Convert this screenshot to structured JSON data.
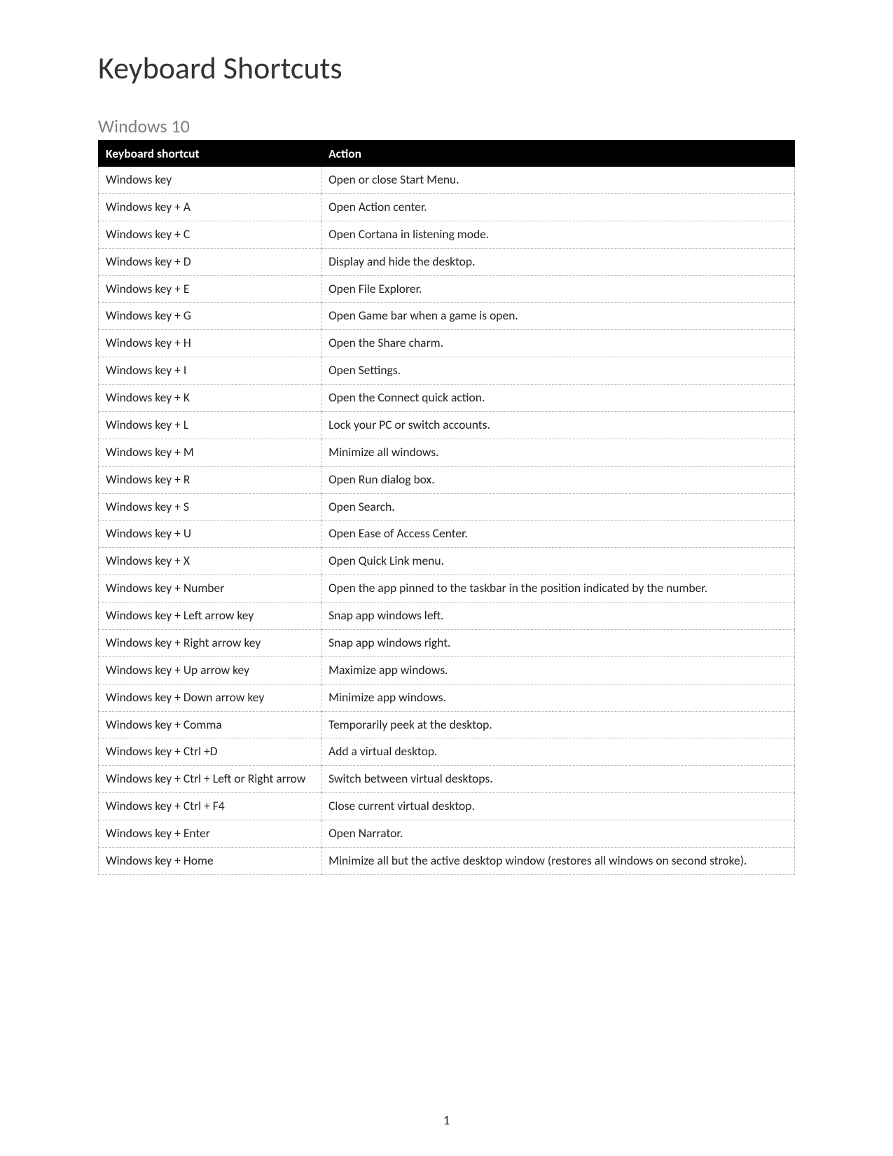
{
  "title": "Keyboard Shortcuts",
  "section": "Windows 10",
  "page_number": "1",
  "table": {
    "headers": {
      "shortcut": "Keyboard shortcut",
      "action": "Action"
    },
    "rows": [
      {
        "shortcut": "Windows key",
        "action": "Open or close Start Menu."
      },
      {
        "shortcut": "Windows key + A",
        "action": "Open Action center."
      },
      {
        "shortcut": "Windows key + C",
        "action": "Open Cortana in listening mode."
      },
      {
        "shortcut": "Windows key + D",
        "action": "Display and hide the desktop."
      },
      {
        "shortcut": "Windows key + E",
        "action": "Open File Explorer."
      },
      {
        "shortcut": "Windows key + G",
        "action": "Open Game bar when a game is open."
      },
      {
        "shortcut": "Windows key + H",
        "action": "Open the Share charm."
      },
      {
        "shortcut": "Windows key + I",
        "action": "Open Settings."
      },
      {
        "shortcut": "Windows key + K",
        "action": "Open the Connect quick action."
      },
      {
        "shortcut": "Windows key + L",
        "action": "Lock your PC or switch accounts."
      },
      {
        "shortcut": "Windows key + M",
        "action": "Minimize all windows."
      },
      {
        "shortcut": "Windows key + R",
        "action": "Open Run dialog box."
      },
      {
        "shortcut": "Windows key + S",
        "action": "Open Search."
      },
      {
        "shortcut": "Windows key + U",
        "action": "Open Ease of Access Center."
      },
      {
        "shortcut": "Windows key + X",
        "action": "Open Quick Link menu."
      },
      {
        "shortcut": "Windows key + Number",
        "action": "Open the app pinned to the taskbar in the position indicated by the number."
      },
      {
        "shortcut": "Windows key + Left arrow key",
        "action": "Snap app windows left."
      },
      {
        "shortcut": "Windows key + Right arrow key",
        "action": "Snap app windows right."
      },
      {
        "shortcut": "Windows key + Up arrow key",
        "action": "Maximize app windows."
      },
      {
        "shortcut": "Windows key + Down arrow key",
        "action": "Minimize app windows."
      },
      {
        "shortcut": "Windows key + Comma",
        "action": "Temporarily peek at the desktop."
      },
      {
        "shortcut": "Windows key + Ctrl +D",
        "action": "Add a virtual desktop."
      },
      {
        "shortcut": "Windows key + Ctrl + Left or Right arrow",
        "action": "Switch between virtual desktops."
      },
      {
        "shortcut": "Windows key + Ctrl + F4",
        "action": "Close current virtual desktop."
      },
      {
        "shortcut": "Windows key + Enter",
        "action": "Open Narrator."
      },
      {
        "shortcut": "Windows key + Home",
        "action": "Minimize all but the active desktop window (restores all windows on second stroke)."
      }
    ]
  }
}
